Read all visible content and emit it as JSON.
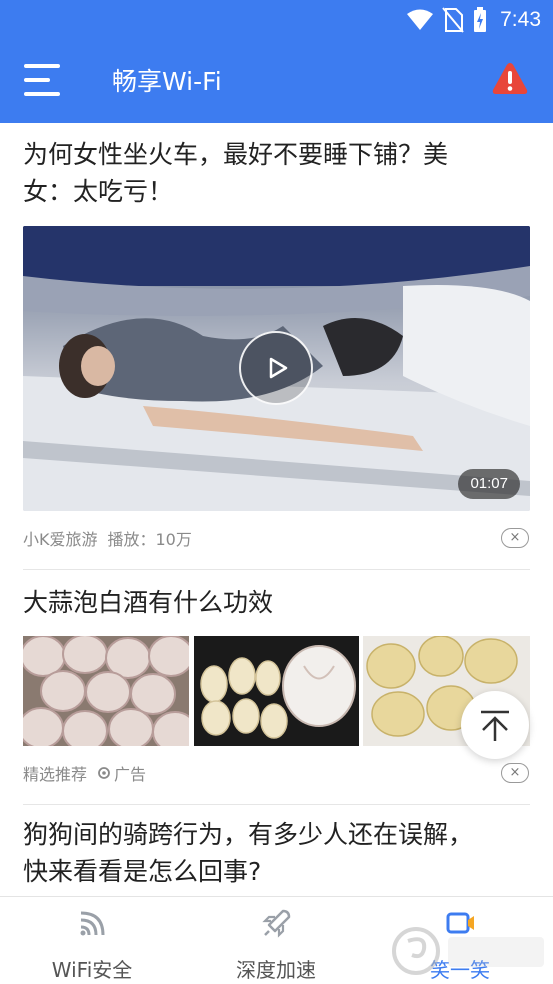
{
  "status_bar": {
    "time": "7:43"
  },
  "app_bar": {
    "title": "畅享Wi-Fi",
    "menu_icon": "hamburger-menu-icon",
    "alert_icon": "warning-alert-icon",
    "accent": "#3D7CF0",
    "alert_color": "#E8463A"
  },
  "feed": {
    "article1": {
      "title_line1": "为何女性坐火车，最好不要睡下铺？美",
      "title_line2": "女：太吃亏！",
      "duration": "01:07",
      "source": "小K爱旅游",
      "plays": "播放：10万"
    },
    "article2": {
      "title": "大蒜泡白酒有什么功效",
      "tag": "精选推荐",
      "ad_label": "广告"
    },
    "article3": {
      "title_line1": "狗狗间的骑跨行为，有多少人还在误解，",
      "title_line2": "快来看看是怎么回事?"
    },
    "close_glyph": "×"
  },
  "bottom_nav": {
    "items": [
      {
        "label": "WiFi安全",
        "icon": "wifi-security-icon"
      },
      {
        "label": "深度加速",
        "icon": "rocket-boost-icon"
      },
      {
        "label": "笑一笑",
        "icon": "video-camera-icon",
        "active": true
      }
    ]
  }
}
